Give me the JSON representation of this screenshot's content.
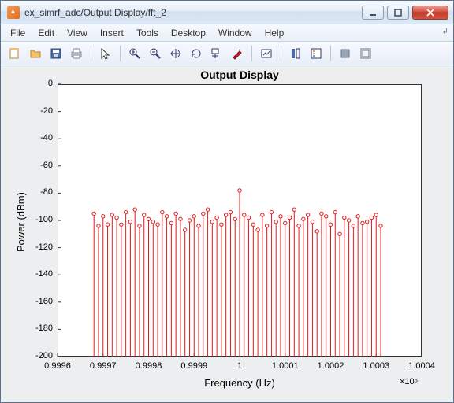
{
  "window": {
    "title": "ex_simrf_adc/Output Display/fft_2"
  },
  "menu": {
    "items": [
      "File",
      "Edit",
      "View",
      "Insert",
      "Tools",
      "Desktop",
      "Window",
      "Help"
    ]
  },
  "toolbar": {
    "icons": [
      "new-figure-icon",
      "open-icon",
      "save-icon",
      "print-icon",
      "sep",
      "pointer-icon",
      "sep",
      "zoom-in-icon",
      "zoom-out-icon",
      "pan-icon",
      "rotate-icon",
      "data-cursor-icon",
      "brush-icon",
      "sep",
      "link-icon",
      "sep",
      "colorbar-icon",
      "legend-icon",
      "sep",
      "hide-tools-icon",
      "dock-icon"
    ]
  },
  "chart_data": {
    "type": "stem",
    "title": "Output Display",
    "xlabel": "Frequency (Hz)",
    "ylabel": "Power (dBm)",
    "xlim": [
      0.9996,
      1.0004
    ],
    "ylim": [
      -200,
      0
    ],
    "xticks": [
      0.9996,
      0.9997,
      0.9998,
      0.9999,
      1,
      1.0001,
      1.0002,
      1.0003,
      1.0004
    ],
    "yticks": [
      0,
      -20,
      -40,
      -60,
      -80,
      -100,
      -120,
      -140,
      -160,
      -180,
      -200
    ],
    "x_multiplier_label": "×10⁵",
    "baseline": -200,
    "x": [
      0.99968,
      0.99969,
      0.9997,
      0.99971,
      0.99972,
      0.99973,
      0.99974,
      0.99975,
      0.99976,
      0.99977,
      0.99978,
      0.99979,
      0.9998,
      0.99981,
      0.99982,
      0.99983,
      0.99984,
      0.99985,
      0.99986,
      0.99987,
      0.99988,
      0.99989,
      0.9999,
      0.99991,
      0.99992,
      0.99993,
      0.99994,
      0.99995,
      0.99996,
      0.99997,
      0.99998,
      0.99999,
      1.0,
      1.00001,
      1.00002,
      1.00003,
      1.00004,
      1.00005,
      1.00006,
      1.00007,
      1.00008,
      1.00009,
      1.0001,
      1.00011,
      1.00012,
      1.00013,
      1.00014,
      1.00015,
      1.00016,
      1.00017,
      1.00018,
      1.00019,
      1.0002,
      1.00021,
      1.00022,
      1.00023,
      1.00024,
      1.00025,
      1.00026,
      1.00027,
      1.00028,
      1.00029,
      1.0003,
      1.00031
    ],
    "y": [
      -95,
      -104,
      -97,
      -103,
      -96,
      -98,
      -103,
      -94,
      -101,
      -92,
      -104,
      -96,
      -99,
      -101,
      -103,
      -94,
      -97,
      -102,
      -95,
      -99,
      -107,
      -100,
      -97,
      -104,
      -95,
      -92,
      -101,
      -98,
      -103,
      -96,
      -94,
      -99,
      -78,
      -96,
      -98,
      -103,
      -107,
      -96,
      -104,
      -94,
      -101,
      -97,
      -102,
      -98,
      -92,
      -104,
      -99,
      -96,
      -101,
      -108,
      -95,
      -97,
      -103,
      -94,
      -110,
      -98,
      -100,
      -104,
      -97,
      -102,
      -101,
      -98,
      -96,
      -104
    ],
    "color": "#e31a1c"
  }
}
